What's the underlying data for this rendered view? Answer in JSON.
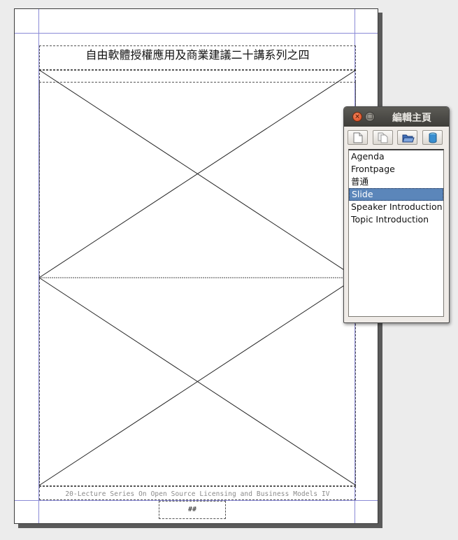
{
  "slide": {
    "title": "自由軟體授權應用及商業建議二十講系列之四",
    "footer": "20-Lecture Series On Open Source Licensing and Business Models IV",
    "page_number": "##"
  },
  "dialog": {
    "title": "編輯主頁",
    "toolbar": [
      {
        "name": "new-page-icon"
      },
      {
        "name": "copy-page-icon"
      },
      {
        "name": "open-folder-icon"
      },
      {
        "name": "delete-icon"
      }
    ],
    "items": [
      {
        "label": "Agenda",
        "selected": false
      },
      {
        "label": "Frontpage",
        "selected": false
      },
      {
        "label": "普通",
        "selected": false
      },
      {
        "label": "Slide",
        "selected": true
      },
      {
        "label": "Speaker Introduction",
        "selected": false
      },
      {
        "label": "Topic Introduction",
        "selected": false
      }
    ]
  },
  "colors": {
    "guide_lines": "#8a8ad6",
    "selection": "#5b86ba"
  }
}
